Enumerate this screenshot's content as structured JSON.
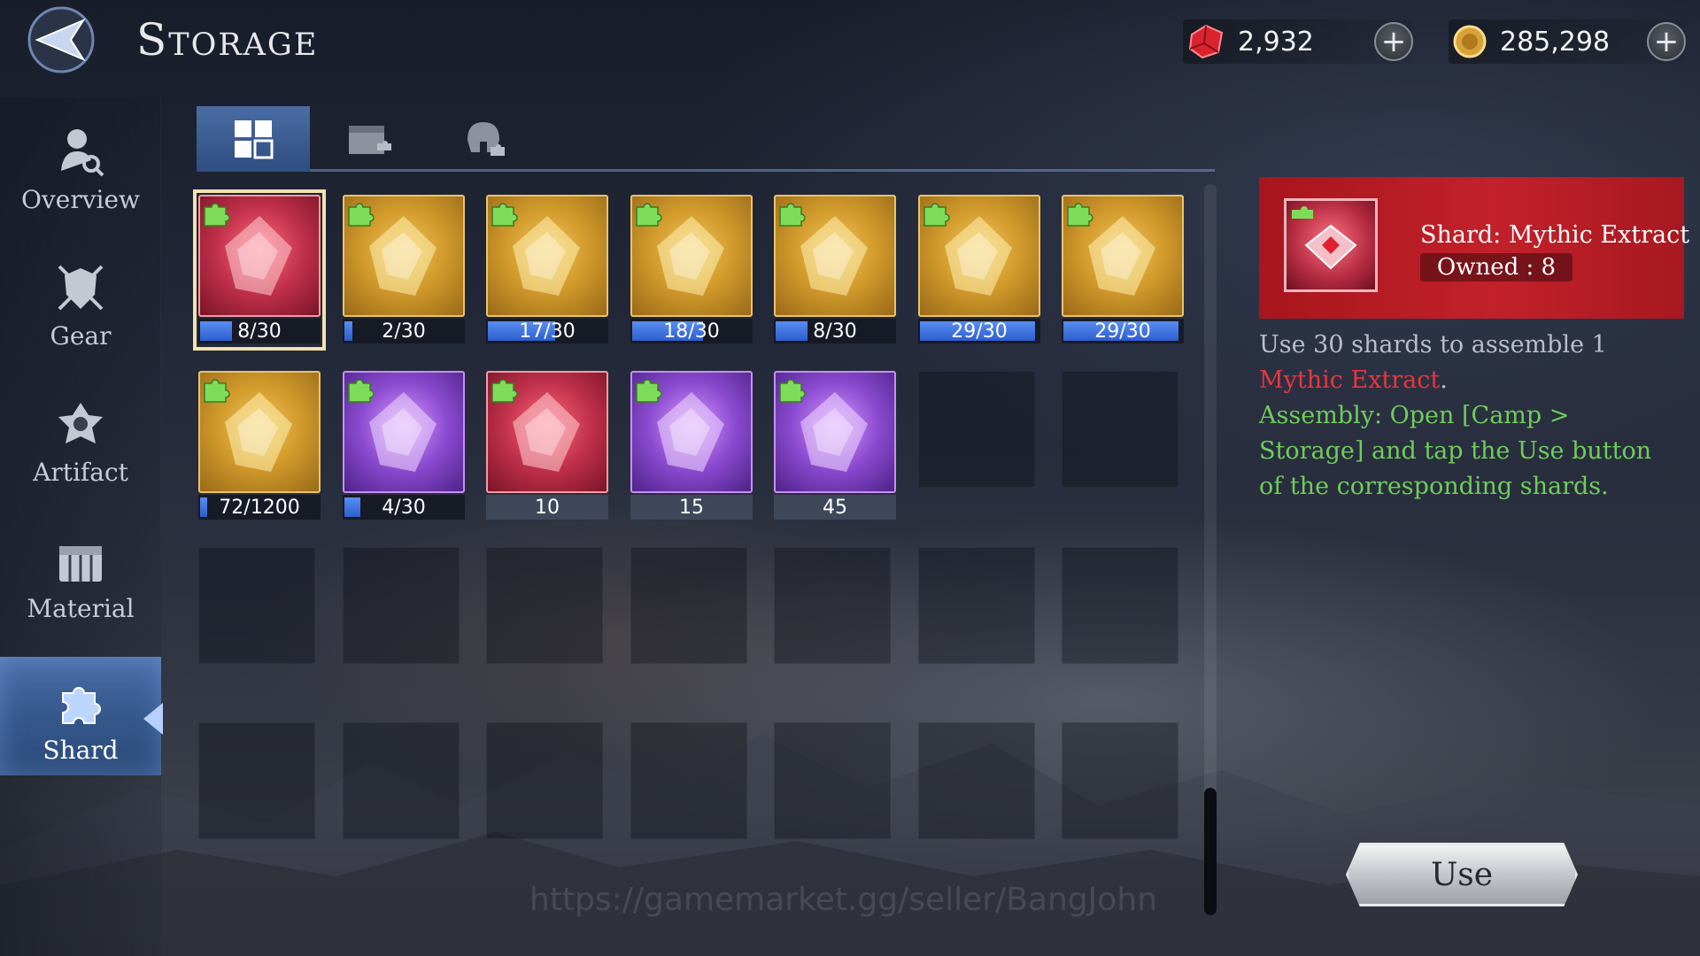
{
  "header": {
    "title": "Storage",
    "currencies": [
      {
        "icon": "red-gem-icon",
        "value": "2,932"
      },
      {
        "icon": "gold-coin-icon",
        "value": "285,298"
      }
    ],
    "plus_label": "+"
  },
  "sidebar": {
    "items": [
      {
        "label": "Overview",
        "icon": "overview-icon"
      },
      {
        "label": "Gear",
        "icon": "gear-shield-icon"
      },
      {
        "label": "Artifact",
        "icon": "artifact-icon"
      },
      {
        "label": "Material",
        "icon": "material-chest-icon"
      },
      {
        "label": "Shard",
        "icon": "puzzle-piece-icon",
        "active": true
      }
    ]
  },
  "tabs": [
    {
      "icon": "grid-all-icon",
      "active": true
    },
    {
      "icon": "chest-shard-icon",
      "active": false
    },
    {
      "icon": "helmet-shard-icon",
      "active": false
    }
  ],
  "grid": {
    "items": [
      {
        "rarity": "red",
        "caption": "8/30",
        "progress": 0.267,
        "selected": true
      },
      {
        "rarity": "gold",
        "caption": "2/30",
        "progress": 0.067
      },
      {
        "rarity": "gold",
        "caption": "17/30",
        "progress": 0.567
      },
      {
        "rarity": "gold",
        "caption": "18/30",
        "progress": 0.6
      },
      {
        "rarity": "gold",
        "caption": "8/30",
        "progress": 0.267
      },
      {
        "rarity": "gold",
        "caption": "29/30",
        "progress": 0.967
      },
      {
        "rarity": "gold",
        "caption": "29/30",
        "progress": 0.967
      },
      {
        "rarity": "gold",
        "caption": "72/1200",
        "progress": 0.06
      },
      {
        "rarity": "purple",
        "caption": "4/30",
        "progress": 0.133
      },
      {
        "rarity": "red",
        "caption": "10",
        "progress": null
      },
      {
        "rarity": "purple",
        "caption": "15",
        "progress": null
      },
      {
        "rarity": "purple",
        "caption": "45",
        "progress": null
      }
    ]
  },
  "detail": {
    "name": "Shard: Mythic Extract",
    "owned": "Owned : 8",
    "desc_plain": "Use 30 shards to assemble 1 ",
    "desc_highlight": "Mythic Extract",
    "desc_end": ".",
    "assembly": "Assembly: Open [Camp > Storage] and tap the Use button of the corresponding shards.",
    "use_label": "Use"
  },
  "watermark": "https://gamemarket.gg/seller/BangJohn",
  "colors": {
    "accent_blue": "#35588c",
    "mythic_red": "#e8363e",
    "assembly_green": "#6fcd5a"
  }
}
